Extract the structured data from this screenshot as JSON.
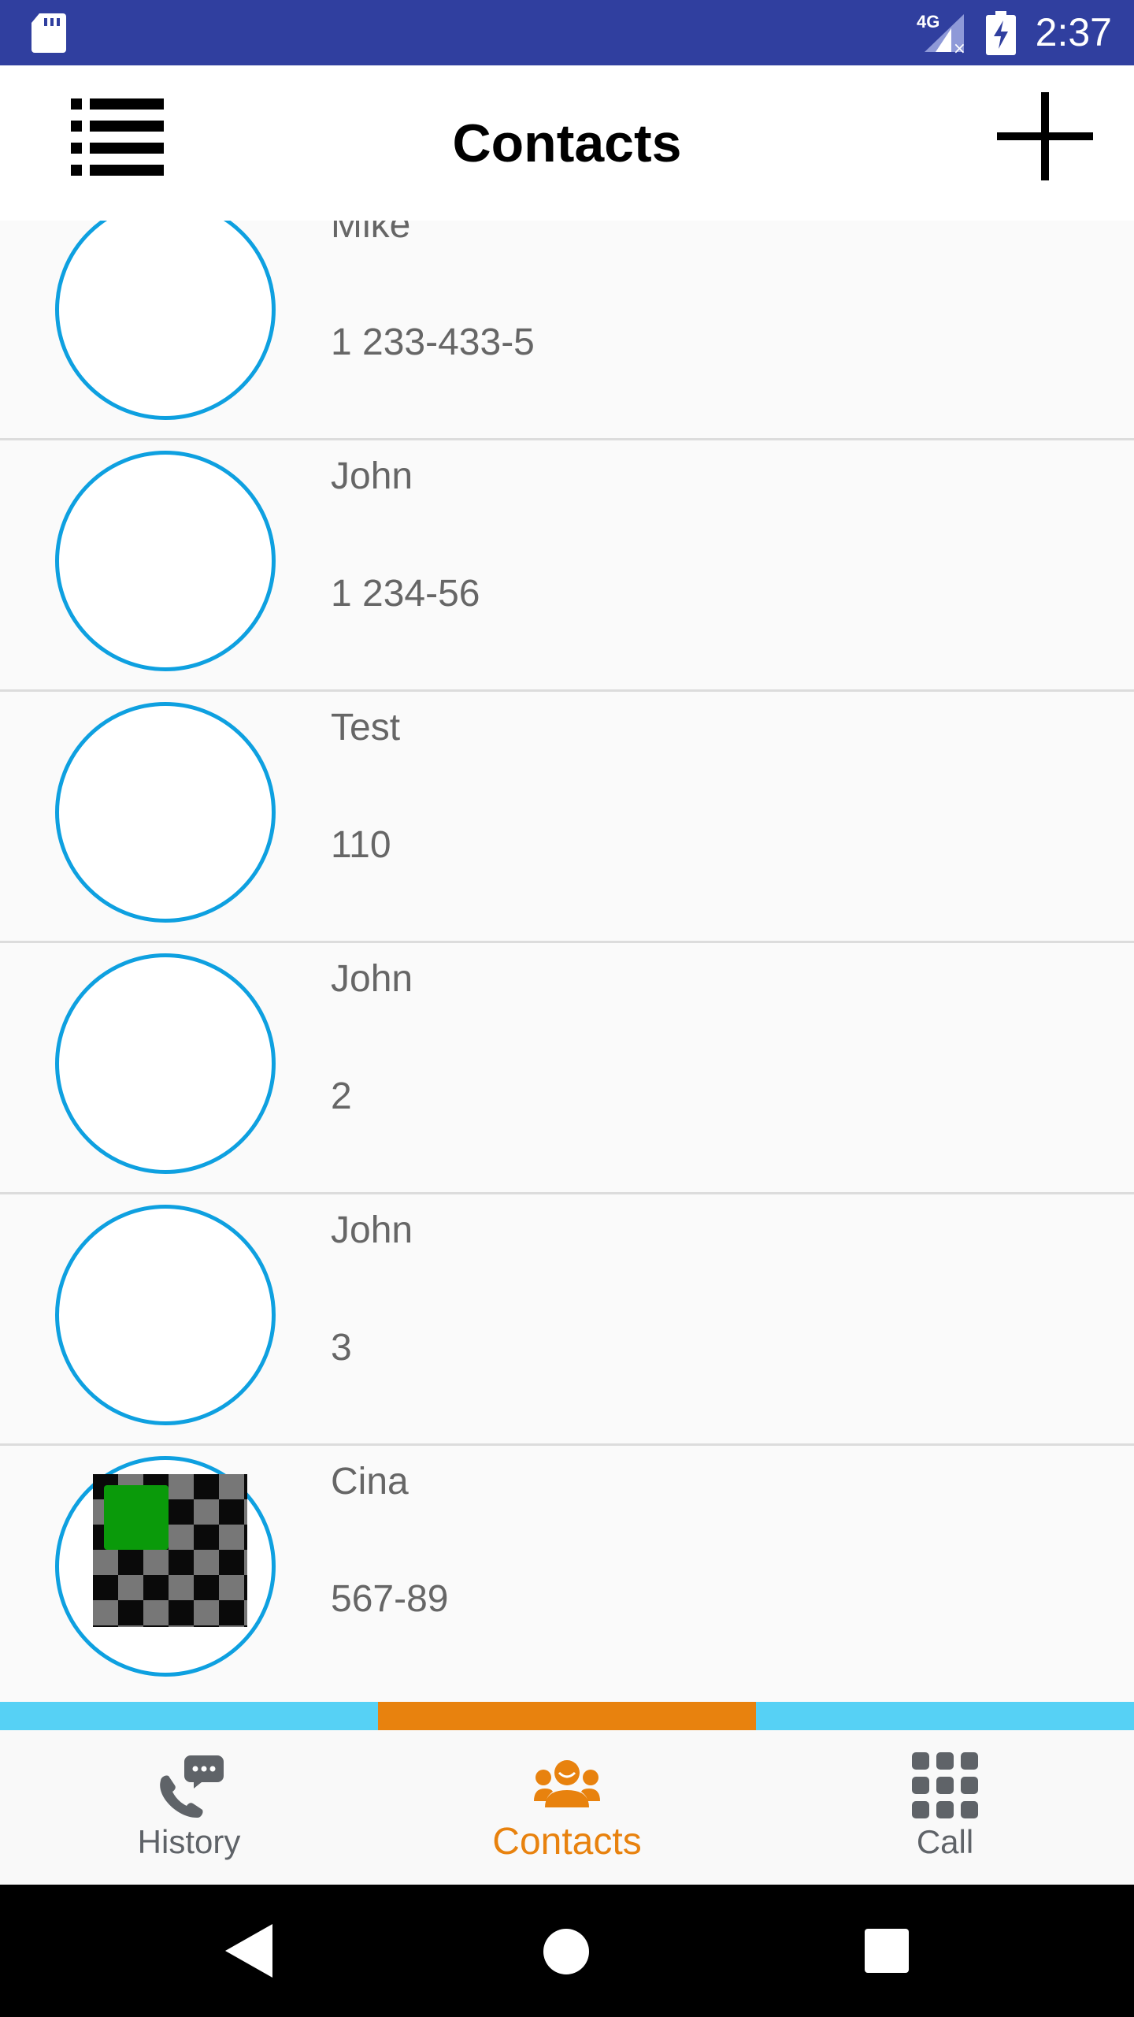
{
  "status_bar": {
    "network": "4G",
    "time": "2:37",
    "color": "#303f9f"
  },
  "app_bar": {
    "title": "Contacts",
    "menu_icon": "list-menu-icon",
    "add_icon": "plus-icon"
  },
  "contacts": [
    {
      "name": "Mike",
      "number": "1 233-433-5",
      "avatar": "empty"
    },
    {
      "name": "John",
      "number": "1 234-56",
      "avatar": "empty"
    },
    {
      "name": "Test",
      "number": "110",
      "avatar": "empty"
    },
    {
      "name": "John",
      "number": "2",
      "avatar": "empty"
    },
    {
      "name": "John",
      "number": "3",
      "avatar": "empty"
    },
    {
      "name": "Cina",
      "number": "567-89",
      "avatar": "photo"
    }
  ],
  "tabs": [
    {
      "label": "History",
      "icon": "phone-chat-icon",
      "active": false
    },
    {
      "label": "Contacts",
      "icon": "contacts-group-icon",
      "active": true
    },
    {
      "label": "Call",
      "icon": "dialpad-icon",
      "active": false
    }
  ],
  "colors": {
    "accent_orange": "#e8820e",
    "tab_blue": "#56d1f5",
    "avatar_ring": "#0ea0e0"
  }
}
